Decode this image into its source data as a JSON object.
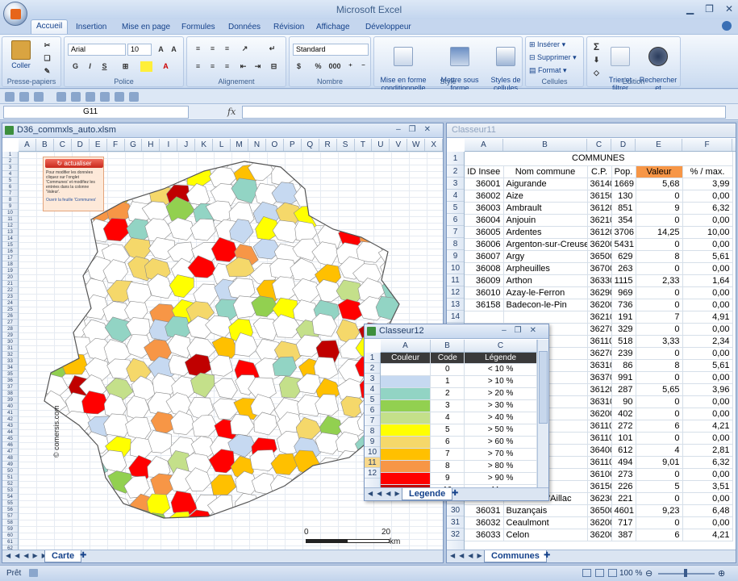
{
  "app_title": "Microsoft Excel",
  "ribbon_tabs": [
    "Accueil",
    "Insertion",
    "Mise en page",
    "Formules",
    "Données",
    "Révision",
    "Affichage",
    "Développeur"
  ],
  "ribbon": {
    "clipboard": {
      "paste": "Coller",
      "label": "Presse-papiers"
    },
    "font": {
      "name": "Arial",
      "size": "10",
      "label": "Police",
      "bold": "G",
      "italic": "I",
      "underline": "S"
    },
    "alignment": {
      "label": "Alignement"
    },
    "number": {
      "format": "Standard",
      "label": "Nombre",
      "percent": "%",
      "thousands": "000"
    },
    "style": {
      "cond": "Mise en forme\nconditionnelle",
      "table": "Mettre sous forme\nde tableau",
      "cell": "Styles de\ncellules",
      "label": "Style"
    },
    "cells": {
      "insert": "Insérer",
      "delete": "Supprimer",
      "format": "Format",
      "label": "Cellules"
    },
    "editing": {
      "sort": "Trier et\nfiltrer",
      "find": "Rechercher et\nsélectionner",
      "label": "Édition",
      "sum": "Σ"
    }
  },
  "name_box": "G11",
  "fx_label": "fx",
  "map_window": {
    "title": "D36_commxls_auto.xlsm",
    "columns": [
      "A",
      "B",
      "C",
      "D",
      "E",
      "F",
      "G",
      "H",
      "I",
      "J",
      "K",
      "L",
      "M",
      "N",
      "O",
      "P",
      "Q",
      "R",
      "S",
      "T",
      "U",
      "V",
      "W",
      "X"
    ],
    "button": "actualiser",
    "note": "Pour modifier les données cliquez sur l'onglet 'Communes' et modifiez les entrées dans la colonne 'Valeur'.",
    "note_link": "Ouvrir la feuille 'Communes'",
    "copyright": "© comersis.com",
    "scale_start": "0",
    "scale_end": "20",
    "scale_unit": "km",
    "sheet_tab": "Carte"
  },
  "communes_window": {
    "title": "Classeur11",
    "columns": [
      "A",
      "B",
      "C",
      "D",
      "E",
      "F"
    ],
    "title_row": "COMMUNES",
    "headers": [
      "ID Insee",
      "Nom commune",
      "C.P.",
      "Pop.",
      "Valeur",
      "% / max."
    ],
    "rows": [
      [
        "36001",
        "Aigurande",
        "36140",
        "1669",
        "5,68",
        "3,99"
      ],
      [
        "36002",
        "Aize",
        "36150",
        "130",
        "0",
        "0,00"
      ],
      [
        "36003",
        "Ambrault",
        "36120",
        "851",
        "9",
        "6,32"
      ],
      [
        "36004",
        "Anjouin",
        "36210",
        "354",
        "0",
        "0,00"
      ],
      [
        "36005",
        "Ardentes",
        "36120",
        "3706",
        "14,25",
        "10,00"
      ],
      [
        "36006",
        "Argenton-sur-Creuse",
        "36200",
        "5431",
        "0",
        "0,00"
      ],
      [
        "36007",
        "Argy",
        "36500",
        "629",
        "8",
        "5,61"
      ],
      [
        "36008",
        "Arpheuilles",
        "36700",
        "263",
        "0",
        "0,00"
      ],
      [
        "36009",
        "Arthon",
        "36330",
        "1115",
        "2,33",
        "1,64"
      ],
      [
        "36010",
        "Azay-le-Ferron",
        "36290",
        "969",
        "0",
        "0,00"
      ],
      [
        "36158",
        "Badecon-le-Pin",
        "36200",
        "736",
        "0",
        "0,00"
      ],
      [
        "",
        "",
        "36210",
        "191",
        "7",
        "4,91"
      ],
      [
        "",
        "",
        "36270",
        "329",
        "0",
        "0,00"
      ],
      [
        "",
        "",
        "36110",
        "518",
        "3,33",
        "2,34"
      ],
      [
        "",
        "",
        "36270",
        "239",
        "0",
        "0,00"
      ],
      [
        "",
        "",
        "36310",
        "86",
        "8",
        "5,61"
      ],
      [
        "",
        "",
        "36370",
        "991",
        "0",
        "0,00"
      ],
      [
        "",
        "",
        "36120",
        "287",
        "5,65",
        "3,96"
      ],
      [
        "",
        "",
        "36310",
        "90",
        "0",
        "0,00"
      ],
      [
        "",
        "",
        "36200",
        "402",
        "0",
        "0,00"
      ],
      [
        "",
        "hâteau",
        "36110",
        "272",
        "6",
        "4,21"
      ],
      [
        "",
        "",
        "36110",
        "101",
        "0",
        "0,00"
      ],
      [
        "",
        "",
        "36400",
        "612",
        "4",
        "2,81"
      ],
      [
        "",
        "",
        "36110",
        "494",
        "9,01",
        "6,32"
      ],
      [
        "",
        "",
        "36100",
        "273",
        "0",
        "0,00"
      ],
      [
        "",
        "Buxeuil",
        "36150",
        "226",
        "5",
        "3,51"
      ],
      [
        "36030",
        "Buxières-d'Aillac",
        "36230",
        "221",
        "0",
        "0,00"
      ],
      [
        "36031",
        "Buzançais",
        "36500",
        "4601",
        "9,23",
        "6,48"
      ],
      [
        "36032",
        "Ceaulmont",
        "36200",
        "717",
        "0",
        "0,00"
      ],
      [
        "36033",
        "Celon",
        "36200",
        "387",
        "6",
        "4,21"
      ]
    ],
    "sheet_tab": "Communes"
  },
  "legend_window": {
    "title": "Classeur12",
    "columns": [
      "A",
      "B",
      "C"
    ],
    "headers": [
      "Couleur",
      "Code",
      "Légende"
    ],
    "rows": [
      {
        "code": "0",
        "label": "< 10 %",
        "color": "#ffffff"
      },
      {
        "code": "1",
        "label": "> 10 %",
        "color": "#c6d9f1"
      },
      {
        "code": "2",
        "label": "> 20 %",
        "color": "#92d4c4"
      },
      {
        "code": "3",
        "label": "> 30 %",
        "color": "#92d050"
      },
      {
        "code": "4",
        "label": "> 40 %",
        "color": "#c4e08a"
      },
      {
        "code": "5",
        "label": "> 50 %",
        "color": "#ffff00"
      },
      {
        "code": "6",
        "label": "> 60 %",
        "color": "#f5d86a"
      },
      {
        "code": "7",
        "label": "> 70 %",
        "color": "#ffc000"
      },
      {
        "code": "8",
        "label": "> 80 %",
        "color": "#f79646"
      },
      {
        "code": "9",
        "label": "> 90 %",
        "color": "#ff0000"
      },
      {
        "code": "10",
        "label": "Max.",
        "color": "#c00000"
      }
    ],
    "sheet_tab": "Legende"
  },
  "status": {
    "ready": "Prêt",
    "zoom": "100 %"
  }
}
